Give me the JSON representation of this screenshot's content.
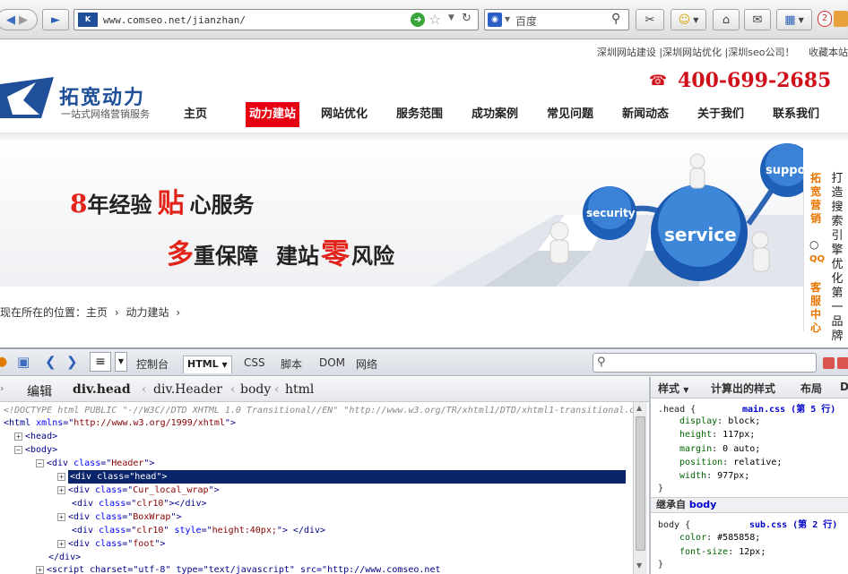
{
  "browser": {
    "url": "www.comseo.net/jianzhan/",
    "search_engine": "百度",
    "badge_count": "2"
  },
  "site": {
    "top_links": "深圳网站建设 |深圳网站优化 |深圳seo公司！",
    "bookmark": "收藏本站",
    "phone": "400-699-2685",
    "logo_name": "拓宽动力",
    "logo_sub": "一站式网络营销服务",
    "nav": [
      "主页",
      "动力建站",
      "网站优化",
      "服务范围",
      "成功案例",
      "常见问题",
      "新闻动态",
      "关于我们",
      "联系我们"
    ],
    "nav_active_index": 1,
    "banner": {
      "line1_red": "8",
      "line1": "年经验",
      "line1_red2": "贴",
      "line1_end": "心服务",
      "line2_red": "多",
      "line2": "重保障",
      "line2_b": "建站",
      "line2_red2": "零",
      "line2_end": "风险",
      "sphere_security": "security",
      "sphere_service": "service",
      "sphere_support": "support"
    },
    "side_ribbon": {
      "brand": "拓宽营销",
      "qq": "QQ",
      "service": "客服中心",
      "slogan": "打造搜索引擎优化第一品牌"
    },
    "breadcrumb": {
      "prefix": "现在所在的位置：",
      "home": "主页",
      "current": "动力建站"
    }
  },
  "firebug": {
    "tabs": [
      "控制台",
      "HTML",
      "CSS",
      "脚本",
      "DOM",
      "网络"
    ],
    "active_tab": "HTML",
    "crumbs": {
      "edit": "编辑",
      "items": [
        "div.head",
        "div.Header",
        "body",
        "html"
      ]
    },
    "html_lines": [
      {
        "t": "doctype",
        "text": "<!DOCTYPE html PUBLIC \"-//W3C//DTD XHTML 1.0 Transitional//EN\" \"http://www.w3.org/TR/xhtml1/DTD/xhtml1-transitional.d"
      },
      {
        "t": "open",
        "tag": "html",
        "attr": "xmlns",
        "val": "http://www.w3.org/1999/xhtml",
        "indent": 0
      },
      {
        "t": "fold",
        "text": "<head>",
        "indent": 1,
        "sign": "+"
      },
      {
        "t": "fold",
        "text": "<body>",
        "indent": 1,
        "sign": "-"
      },
      {
        "t": "div",
        "cls": "Header",
        "indent": 2,
        "sign": "-"
      },
      {
        "t": "div",
        "cls": "head",
        "indent": 3,
        "sign": "+",
        "selected": true
      },
      {
        "t": "div",
        "cls": "Cur_local_wrap",
        "indent": 3,
        "sign": "+"
      },
      {
        "t": "div",
        "cls": "clr10",
        "indent": 3,
        "sign": "",
        "selfclose": true
      },
      {
        "t": "div",
        "cls": "BoxWrap",
        "indent": 3,
        "sign": "+"
      },
      {
        "t": "div",
        "cls": "clr10",
        "indent": 3,
        "sign": "",
        "style": "height:40px;",
        "selfclose": true
      },
      {
        "t": "div",
        "cls": "foot",
        "indent": 3,
        "sign": "+"
      },
      {
        "t": "close",
        "text": "</div>",
        "indent": 2
      },
      {
        "t": "script",
        "text": "<script charset=\"utf-8\" type=\"text/javascript\" src=\"http://www.comseo.net",
        "indent": 2,
        "sign": "+"
      }
    ],
    "side_tabs": [
      "样式",
      "计算出的样式",
      "布局",
      "DO"
    ],
    "rules": [
      {
        "selector": ".head {",
        "source": "main.css (第 5 行)",
        "props": [
          [
            "display",
            "block;"
          ],
          [
            "height",
            "117px;"
          ],
          [
            "margin",
            "0 auto;"
          ],
          [
            "position",
            "relative;"
          ],
          [
            "width",
            "977px;"
          ]
        ]
      },
      {
        "selector": "body {",
        "source": "sub.css (第 2 行)",
        "props": [
          [
            "color",
            "#585858;"
          ],
          [
            "font-size",
            "12px;"
          ]
        ]
      }
    ],
    "inherited": "继承自",
    "inherited_from": "body"
  }
}
